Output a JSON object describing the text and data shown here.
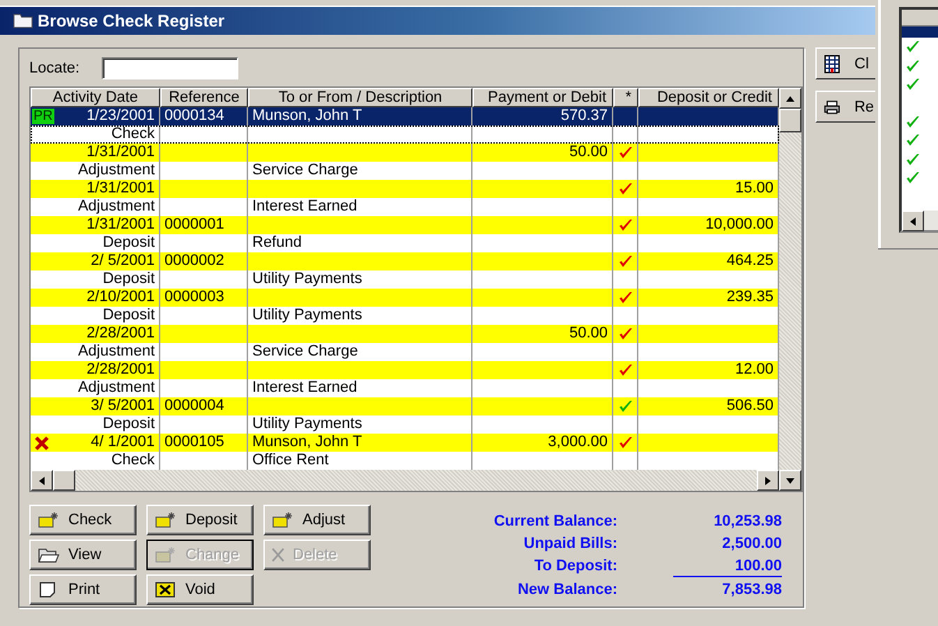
{
  "window": {
    "title": "Browse Check Register"
  },
  "locate": {
    "label": "Locate:"
  },
  "table": {
    "columns": [
      "Activity Date",
      "Reference",
      "To or From / Description",
      "Payment or Debit",
      "*",
      "Deposit or Credit"
    ],
    "rows": [
      {
        "selected": true,
        "badge": "PR",
        "voided": false,
        "date": "1/23/2001",
        "reference": "0000134",
        "payee": "Munson, John T",
        "payment": "570.37",
        "type": "Check"
      },
      {
        "selected": false,
        "voided": false,
        "date": "1/31/2001",
        "payment": "50.00",
        "color": "#e00000",
        "type": "Adjustment",
        "description": "Service Charge"
      },
      {
        "selected": false,
        "voided": false,
        "date": "1/31/2001",
        "color": "#e00000",
        "deposit": "15.00",
        "type": "Adjustment",
        "description": "Interest Earned"
      },
      {
        "selected": false,
        "voided": false,
        "date": "1/31/2001",
        "reference": "0000001",
        "color": "#e00000",
        "deposit": "10,000.00",
        "type": "Deposit",
        "description": "Refund"
      },
      {
        "selected": false,
        "voided": false,
        "date": "2/ 5/2001",
        "reference": "0000002",
        "color": "#e00000",
        "deposit": "464.25",
        "type": "Deposit",
        "description": "Utility Payments"
      },
      {
        "selected": false,
        "voided": false,
        "date": "2/10/2001",
        "reference": "0000003",
        "color": "#e00000",
        "deposit": "239.35",
        "type": "Deposit",
        "description": "Utility Payments"
      },
      {
        "selected": false,
        "voided": false,
        "date": "2/28/2001",
        "payment": "50.00",
        "color": "#e00000",
        "type": "Adjustment",
        "description": "Service Charge"
      },
      {
        "selected": false,
        "voided": false,
        "date": "2/28/2001",
        "color": "#e00000",
        "deposit": "12.00",
        "type": "Adjustment",
        "description": "Interest Earned"
      },
      {
        "selected": false,
        "voided": false,
        "date": "3/ 5/2001",
        "reference": "0000004",
        "color": "#10b010",
        "deposit": "506.50",
        "type": "Deposit",
        "description": "Utility Payments"
      },
      {
        "selected": false,
        "voided": true,
        "date": "4/ 1/2001",
        "reference": "0000105",
        "payee": "Munson, John T",
        "payment": "3,000.00",
        "color": "#e00000",
        "type": "Check",
        "description": "Office Rent"
      }
    ]
  },
  "buttons": [
    {
      "label": "Check",
      "kind": "new",
      "disabled": false
    },
    {
      "label": "Deposit",
      "kind": "new",
      "disabled": false
    },
    {
      "label": "Adjust",
      "kind": "new",
      "disabled": false
    },
    {
      "label": "View",
      "kind": "view",
      "disabled": false
    },
    {
      "label": "Change",
      "kind": "new",
      "disabled": true
    },
    {
      "label": "Delete",
      "kind": "delete",
      "disabled": true
    },
    {
      "label": "Print",
      "kind": "print",
      "disabled": false
    },
    {
      "label": "Void",
      "kind": "void",
      "disabled": false
    }
  ],
  "totals": [
    {
      "label": "Current Balance:",
      "value": "10,253.98",
      "underlined": false
    },
    {
      "label": "Unpaid Bills:",
      "value": "2,500.00",
      "underlined": false
    },
    {
      "label": "To Deposit:",
      "value": "100.00",
      "underlined": true
    },
    {
      "label": "New Balance:",
      "value": "7,853.98",
      "underlined": false
    }
  ],
  "side_buttons": [
    {
      "label": "Cl",
      "kind": "grid"
    },
    {
      "label": "Re",
      "kind": "print"
    }
  ],
  "background_list": {
    "rows": [
      {
        "selected": true,
        "checked": false
      },
      {
        "selected": false,
        "checked": true
      },
      {
        "selected": false,
        "checked": true
      },
      {
        "selected": false,
        "checked": true
      },
      {
        "selected": false,
        "checked": false
      },
      {
        "selected": false,
        "checked": true
      },
      {
        "selected": false,
        "checked": true
      },
      {
        "selected": false,
        "checked": true
      },
      {
        "selected": false,
        "checked": true
      }
    ]
  }
}
